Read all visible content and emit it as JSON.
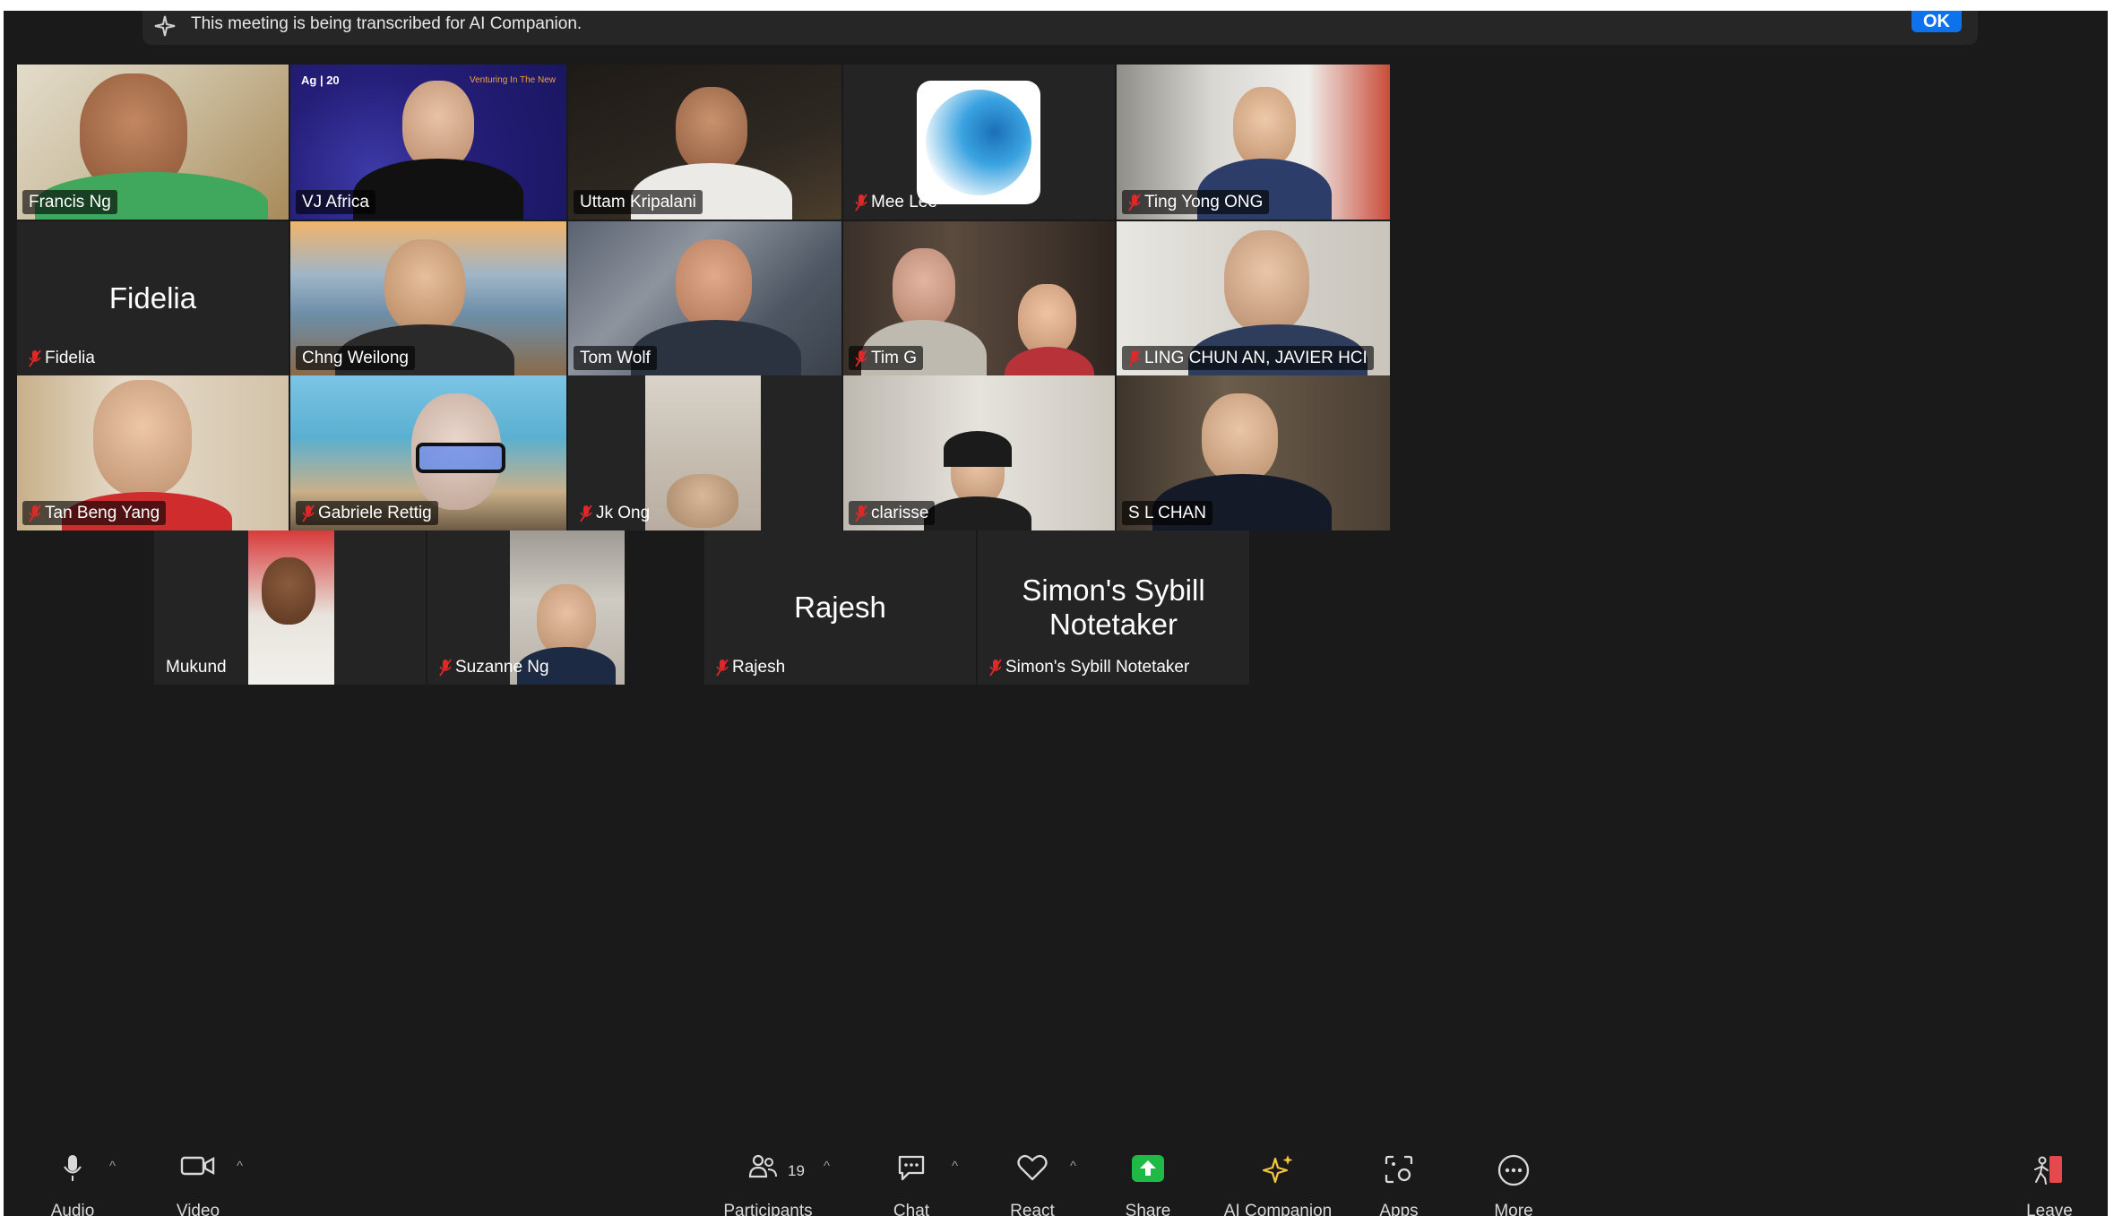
{
  "banner": {
    "text": "This meeting is being transcribed for AI Companion.",
    "ok_label": "OK"
  },
  "tiles": {
    "francis": {
      "name": "Francis Ng"
    },
    "vj": {
      "name": "VJ Africa",
      "bg_logo": "Ag | 20",
      "bg_tagline": "Venturing In The New"
    },
    "uttam": {
      "name": "Uttam Kripalani"
    },
    "mee": {
      "name": "Mee Lee"
    },
    "ting": {
      "name": "Ting Yong ONG"
    },
    "fidelia": {
      "name": "Fidelia",
      "big": "Fidelia"
    },
    "chng": {
      "name": "Chng Weilong"
    },
    "tom": {
      "name": "Tom Wolf"
    },
    "tim": {
      "name": "Tim G"
    },
    "ling": {
      "name": "LING CHUN AN, JAVIER HCI"
    },
    "tan": {
      "name": "Tan Beng Yang"
    },
    "gabriele": {
      "name": "Gabriele Rettig"
    },
    "jk": {
      "name": "Jk Ong"
    },
    "clarisse": {
      "name": "clarisse"
    },
    "sl": {
      "name": "S L CHAN"
    },
    "mukund": {
      "name": "Mukund"
    },
    "suzanne": {
      "name": "Suzanne Ng"
    },
    "rajesh": {
      "name": "Rajesh",
      "big": "Rajesh"
    },
    "simon": {
      "name": "Simon's Sybill Notetaker",
      "big": "Simon's Sybill Notetaker"
    }
  },
  "toolbar": {
    "audio": "Audio",
    "video": "Video",
    "participants": "Participants",
    "participants_count": "19",
    "chat": "Chat",
    "react": "React",
    "share": "Share",
    "ai_companion": "AI Companion",
    "apps": "Apps",
    "more": "More",
    "leave": "Leave"
  },
  "colors": {
    "active_speaker": "#23d959",
    "share_green": "#1fba45",
    "muted_red": "#e02828",
    "ok_blue": "#0e72ed",
    "ai_yellow": "#f4c63d",
    "leave_red": "#e5484d"
  }
}
